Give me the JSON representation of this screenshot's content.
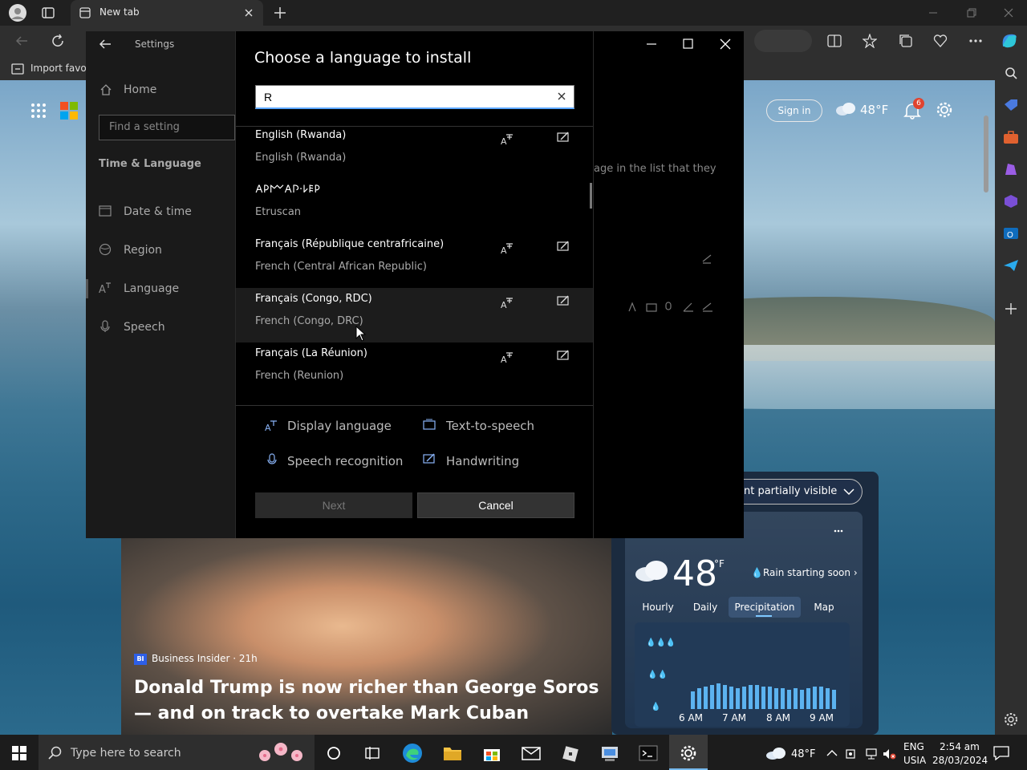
{
  "browser": {
    "tab_title": "New tab",
    "fav_import": "Import favori",
    "signin": "Sign in",
    "weather_top": "48°F",
    "notif_count": "6"
  },
  "news": {
    "source_badge": "BI",
    "source": "Business Insider · 21h",
    "title": "Donald Trump is now richer than George Soros — and on track to overtake Mark Cuban"
  },
  "weather": {
    "pill": "nt partially visible",
    "temp": "48",
    "unit": "°F",
    "rain": "Rain starting soon",
    "tabs": [
      "Hourly",
      "Daily",
      "Precipitation",
      "Map"
    ],
    "active_tab": "Precipitation",
    "time_labels": [
      "6 AM",
      "7 AM",
      "8 AM",
      "9 AM"
    ]
  },
  "settings": {
    "title": "Settings",
    "home": "Home",
    "find_placeholder": "Find a setting",
    "section": "Time & Language",
    "nav": [
      "Date & time",
      "Region",
      "Language",
      "Speech"
    ],
    "bg_text": "age in the list that they"
  },
  "dialog": {
    "title": "Choose a language to install",
    "search_value": "R",
    "languages": [
      {
        "native": "English (Rwanda)",
        "english": "English (Rwanda)",
        "display": true,
        "handwriting": true
      },
      {
        "native": "𐌀𐌓𐌌𐌀𐌐·𐌋𐌄𐌓",
        "english": "Etruscan",
        "display": false,
        "handwriting": false
      },
      {
        "native": "Français (République centrafricaine)",
        "english": "French (Central African Republic)",
        "display": true,
        "handwriting": true
      },
      {
        "native": "Français (Congo, RDC)",
        "english": "French (Congo, DRC)",
        "display": true,
        "handwriting": true
      },
      {
        "native": "Français (La Réunion)",
        "english": "French (Reunion)",
        "display": true,
        "handwriting": true
      }
    ],
    "legend": {
      "display": "Display language",
      "tts": "Text-to-speech",
      "speech": "Speech recognition",
      "handwriting": "Handwriting"
    },
    "next": "Next",
    "cancel": "Cancel"
  },
  "taskbar": {
    "search": "Type here to search",
    "weather": "48°F",
    "lang1": "ENG",
    "lang2": "USIA",
    "time": "2:54 am",
    "date": "28/03/2024"
  }
}
